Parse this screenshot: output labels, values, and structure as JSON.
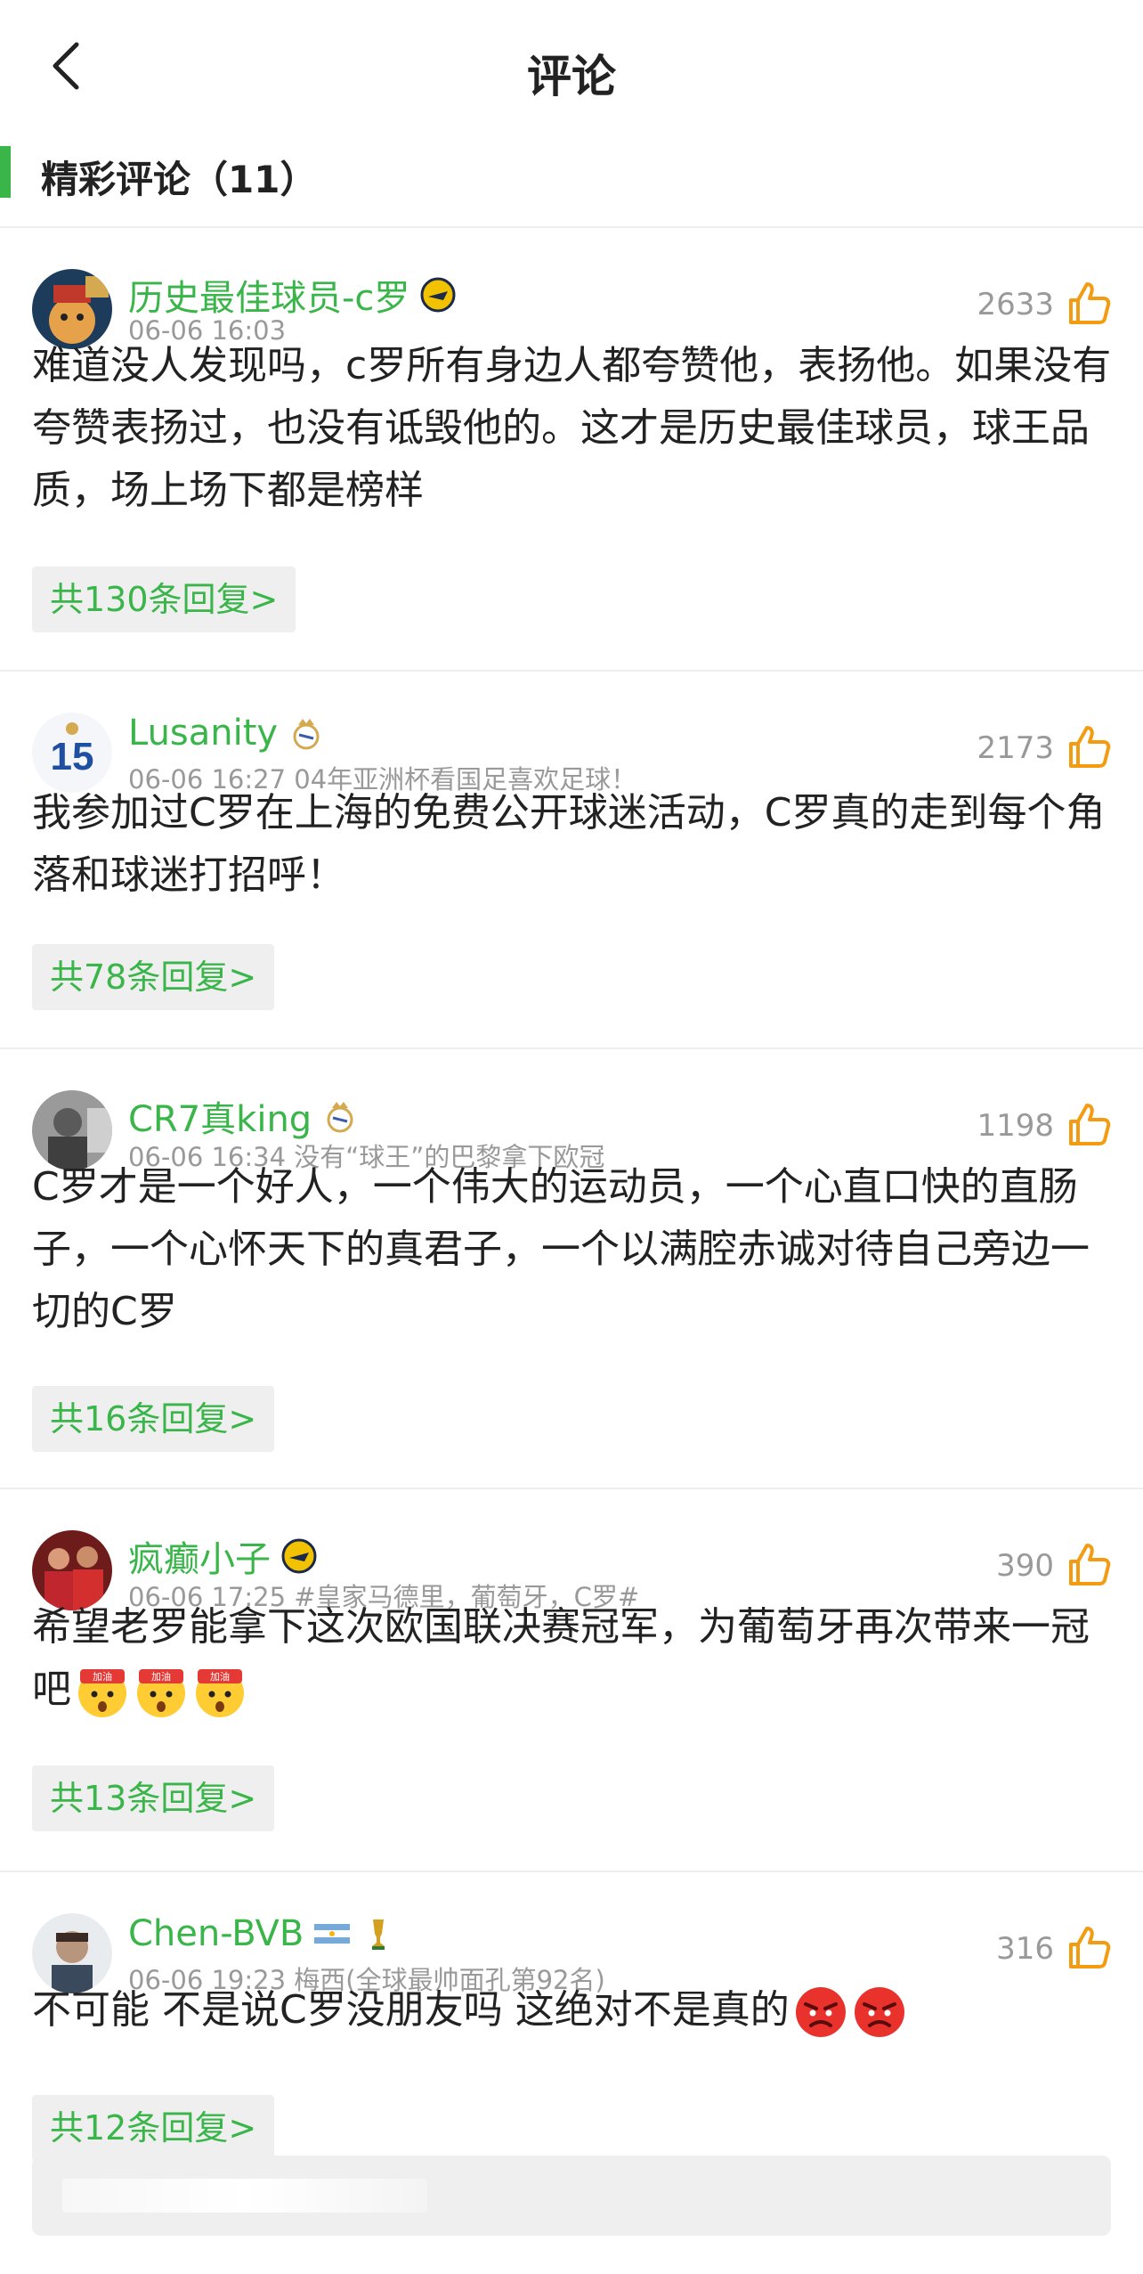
{
  "nav": {
    "title": "评论",
    "back_icon": "chevron-left-icon"
  },
  "section": {
    "title": "精彩评论（11）"
  },
  "colors": {
    "accent": "#3ab54a",
    "like": "#f39c12",
    "meta": "#999999"
  },
  "comments": [
    {
      "name": "历史最佳球员-c罗",
      "meta": "06-06 16:03",
      "likes": "2633",
      "text": "难道没人发现吗，c罗所有身边人都夸赞他，表扬他。如果没有夸赞表扬过，也没有诋毁他的。这才是历史最佳球员，球王品质，场上场下都是榜样",
      "reply": "共130条回复>",
      "badges": [
        "al-nassr-badge-icon"
      ],
      "emojis": []
    },
    {
      "name": "Lusanity",
      "meta": "06-06 16:27 04年亚洲杯看国足喜欢足球！",
      "likes": "2173",
      "text": "我参加过C罗在上海的免费公开球迷活动，C罗真的走到每个角落和球迷打招呼！",
      "reply": "共78条回复>",
      "badges": [
        "real-madrid-badge-icon"
      ],
      "emojis": []
    },
    {
      "name": "CR7真king",
      "meta": "06-06 16:34 没有“球王”的巴黎拿下欧冠",
      "likes": "1198",
      "text": "C罗才是一个好人，一个伟大的运动员，一个心直口快的直肠子，一个心怀天下的真君子，一个以满腔赤诚对待自己旁边一切的C罗",
      "reply": "共16条回复>",
      "badges": [
        "real-madrid-badge-icon"
      ],
      "emojis": []
    },
    {
      "name": "疯癫小子",
      "meta": "06-06 17:25 #皇家马德里，葡萄牙，C罗#",
      "likes": "390",
      "text": "希望老罗能拿下这次欧国联决赛冠军，为葡萄牙再次带来一冠吧",
      "reply": "共13条回复>",
      "badges": [
        "al-nassr-badge-icon"
      ],
      "emojis": [
        "cheer-emoji-icon",
        "cheer-emoji-icon",
        "cheer-emoji-icon"
      ],
      "emoji_label": "加油"
    },
    {
      "name": "Chen-BVB",
      "meta": "06-06 19:23 梅西(全球最帅面孔第92名)",
      "likes": "316",
      "text": "不可能 不是说C罗没朋友吗 这绝对不是真的",
      "reply": "共12条回复>",
      "badges": [
        "argentina-flag-icon",
        "world-cup-trophy-icon"
      ],
      "emojis": [
        "angry-emoji-icon",
        "angry-emoji-icon"
      ]
    }
  ],
  "input": {
    "placeholder": ""
  }
}
